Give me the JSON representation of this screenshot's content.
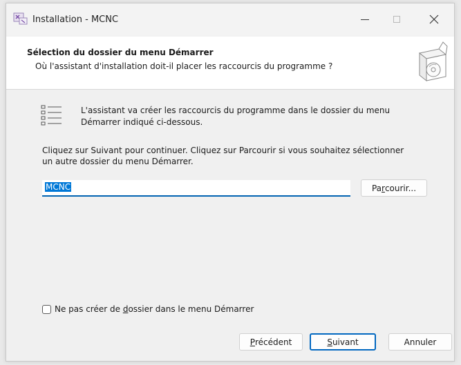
{
  "window": {
    "title": "Installation - MCNC"
  },
  "header": {
    "title": "Sélection du dossier du menu Démarrer",
    "subtitle": "Où l'assistant d'installation doit-il placer les raccourcis du programme ?"
  },
  "content": {
    "info_line1": "L'assistant va créer les raccourcis du programme dans le dossier du menu",
    "info_line2": "Démarrer indiqué ci-dessous.",
    "instr_line1": "Cliquez sur Suivant pour continuer. Cliquez sur Parcourir si vous souhaitez sélectionner",
    "instr_line2": "un autre dossier du menu Démarrer."
  },
  "folder_input": {
    "value": "MCNC"
  },
  "browse_button": {
    "pre": "Pa",
    "accel": "r",
    "post": "courir..."
  },
  "checkbox": {
    "checked": false,
    "pre": "Ne pas créer de ",
    "accel": "d",
    "post": "ossier dans le menu Démarrer"
  },
  "buttons": {
    "back": {
      "pre": "",
      "accel": "P",
      "post": "récédent"
    },
    "next": {
      "pre": "",
      "accel": "S",
      "post": "uivant"
    },
    "cancel": "Annuler"
  },
  "icons": {
    "app": "installer-app-icon",
    "box": "software-box-cd-icon",
    "list": "list-icon",
    "minimize": "minimize-icon",
    "maximize": "maximize-icon",
    "close": "close-icon"
  },
  "colors": {
    "accent": "#0067c0",
    "selection": "#0078d7"
  }
}
